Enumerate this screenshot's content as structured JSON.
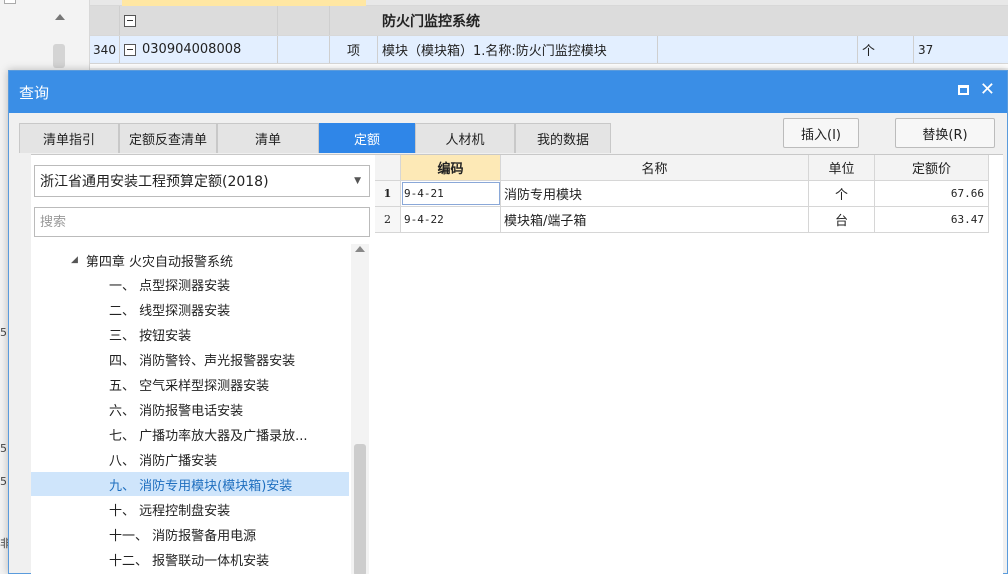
{
  "background": {
    "group_title": "防火门监控系统",
    "row": {
      "index": "340",
      "code": "030904008008",
      "unit_type": "项",
      "description": "模块（模块箱）1.名称:防火门监控模块",
      "unit": "个",
      "quantity": "37"
    },
    "left_fragments": [
      "5",
      "5",
      "5",
      "非"
    ]
  },
  "dialog": {
    "title": "查询",
    "tabs": [
      {
        "label": "清单指引",
        "active": false
      },
      {
        "label": "定额反查清单",
        "active": false
      },
      {
        "label": "清单",
        "active": false
      },
      {
        "label": "定额",
        "active": true
      },
      {
        "label": "人材机",
        "active": false
      },
      {
        "label": "我的数据",
        "active": false
      }
    ],
    "insert_label": "插入(I)",
    "replace_label": "替换(R)",
    "quota_selected": "浙江省通用安装工程预算定额(2018)",
    "search_placeholder": "搜索",
    "tree": {
      "chapter": "第四章 火灾自动报警系统",
      "items": [
        {
          "label": "一、 点型探测器安装",
          "selected": false
        },
        {
          "label": "二、 线型探测器安装",
          "selected": false
        },
        {
          "label": "三、 按钮安装",
          "selected": false
        },
        {
          "label": "四、 消防警铃、声光报警器安装",
          "selected": false
        },
        {
          "label": "五、 空气采样型探测器安装",
          "selected": false
        },
        {
          "label": "六、 消防报警电话安装",
          "selected": false
        },
        {
          "label": "七、 广播功率放大器及广播录放...",
          "selected": false
        },
        {
          "label": "八、 消防广播安装",
          "selected": false
        },
        {
          "label": "九、 消防专用模块(模块箱)安装",
          "selected": true
        },
        {
          "label": "十、 远程控制盘安装",
          "selected": false
        },
        {
          "label": "十一、 消防报警备用电源",
          "selected": false
        },
        {
          "label": "十二、 报警联动一体机安装",
          "selected": false
        }
      ]
    },
    "grid": {
      "headers": {
        "code": "编码",
        "name": "名称",
        "unit": "单位",
        "price": "定额价"
      },
      "rows": [
        {
          "n": "1",
          "code": "9-4-21",
          "name": "消防专用模块",
          "unit": "个",
          "price": "67.66"
        },
        {
          "n": "2",
          "code": "9-4-22",
          "name": "模块箱/端子箱",
          "unit": "台",
          "price": "63.47"
        }
      ]
    },
    "colors": {
      "accent": "#3a8ee6",
      "active_tab": "#2f86e8",
      "header_code": "#fde9b6",
      "selected_tree": "#cfe5fb"
    }
  }
}
